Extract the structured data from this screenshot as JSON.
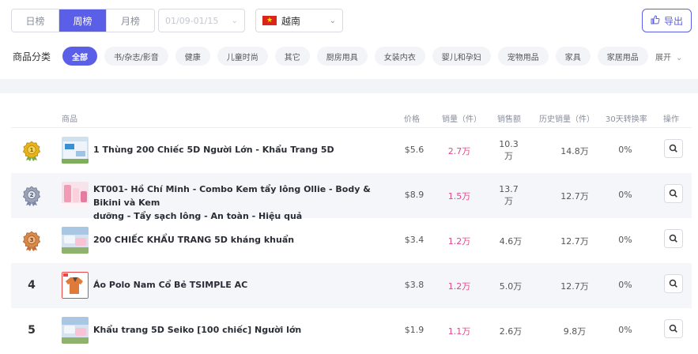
{
  "period_tabs": [
    {
      "label": "日榜",
      "active": false
    },
    {
      "label": "周榜",
      "active": true
    },
    {
      "label": "月榜",
      "active": false
    }
  ],
  "date_range": {
    "placeholder": "01/09-01/15"
  },
  "country": {
    "name": "越南",
    "flag_color": "#da251d",
    "star_color": "#ffdd00"
  },
  "export_label": "导出",
  "category": {
    "label": "商品分类",
    "items": [
      {
        "label": "全部",
        "active": true
      },
      {
        "label": "书/杂志/影音"
      },
      {
        "label": "健康"
      },
      {
        "label": "儿童时尚"
      },
      {
        "label": "其它"
      },
      {
        "label": "厨房用具"
      },
      {
        "label": "女装内衣"
      },
      {
        "label": "婴儿和孕妇"
      },
      {
        "label": "宠物用品"
      },
      {
        "label": "家具"
      },
      {
        "label": "家居用品"
      }
    ],
    "expand_label": "展开"
  },
  "table": {
    "headers": {
      "product": "商品",
      "price": "价格",
      "sales": "销量（件）",
      "revenue": "销售额",
      "history_sales": "历史销量（件）",
      "conversion": "30天转换率",
      "action": "操作"
    },
    "rows": [
      {
        "rank": "1",
        "medal": "gold",
        "name_lines": [
          "1 Thùng 200 Chiếc 5D Người Lớn - Khẩu Trang 5D"
        ],
        "price": "$5.6",
        "sales": "2.7万",
        "revenue_lines": [
          "10.3",
          "万"
        ],
        "history": "14.8万",
        "conversion": "0%"
      },
      {
        "rank": "2",
        "medal": "silver",
        "name_lines": [
          "KT001- Hồ Chí Minh - Combo Kem tẩy lông Ollie - Body & Bikini và Kem",
          "dưỡng - Tẩy sạch lông - An toàn - Hiệu quả"
        ],
        "price": "$8.9",
        "sales": "1.5万",
        "revenue_lines": [
          "13.7",
          "万"
        ],
        "history": "12.7万",
        "conversion": "0%"
      },
      {
        "rank": "3",
        "medal": "bronze",
        "name_lines": [
          "200 CHIẾC KHẨU TRANG 5D kháng khuẩn"
        ],
        "price": "$3.4",
        "sales": "1.2万",
        "revenue_lines": [
          "4.6万"
        ],
        "history": "12.7万",
        "conversion": "0%"
      },
      {
        "rank": "4",
        "medal": "",
        "name_lines": [
          "Áo Polo Nam Cổ Bẻ TSIMPLE AC"
        ],
        "price": "$3.8",
        "sales": "1.2万",
        "revenue_lines": [
          "5.0万"
        ],
        "history": "12.7万",
        "conversion": "0%"
      },
      {
        "rank": "5",
        "medal": "",
        "name_lines": [
          "Khẩu trang 5D Seiko [100 chiếc] Người lớn"
        ],
        "price": "$1.9",
        "sales": "1.1万",
        "revenue_lines": [
          "2.6万"
        ],
        "history": "9.8万",
        "conversion": "0%"
      }
    ]
  },
  "colors": {
    "accent": "#5b5fe8",
    "sales_pink": "#e0478a",
    "gold": "#e8b21c",
    "silver": "#9aa3b8",
    "bronze": "#d98a4a"
  }
}
